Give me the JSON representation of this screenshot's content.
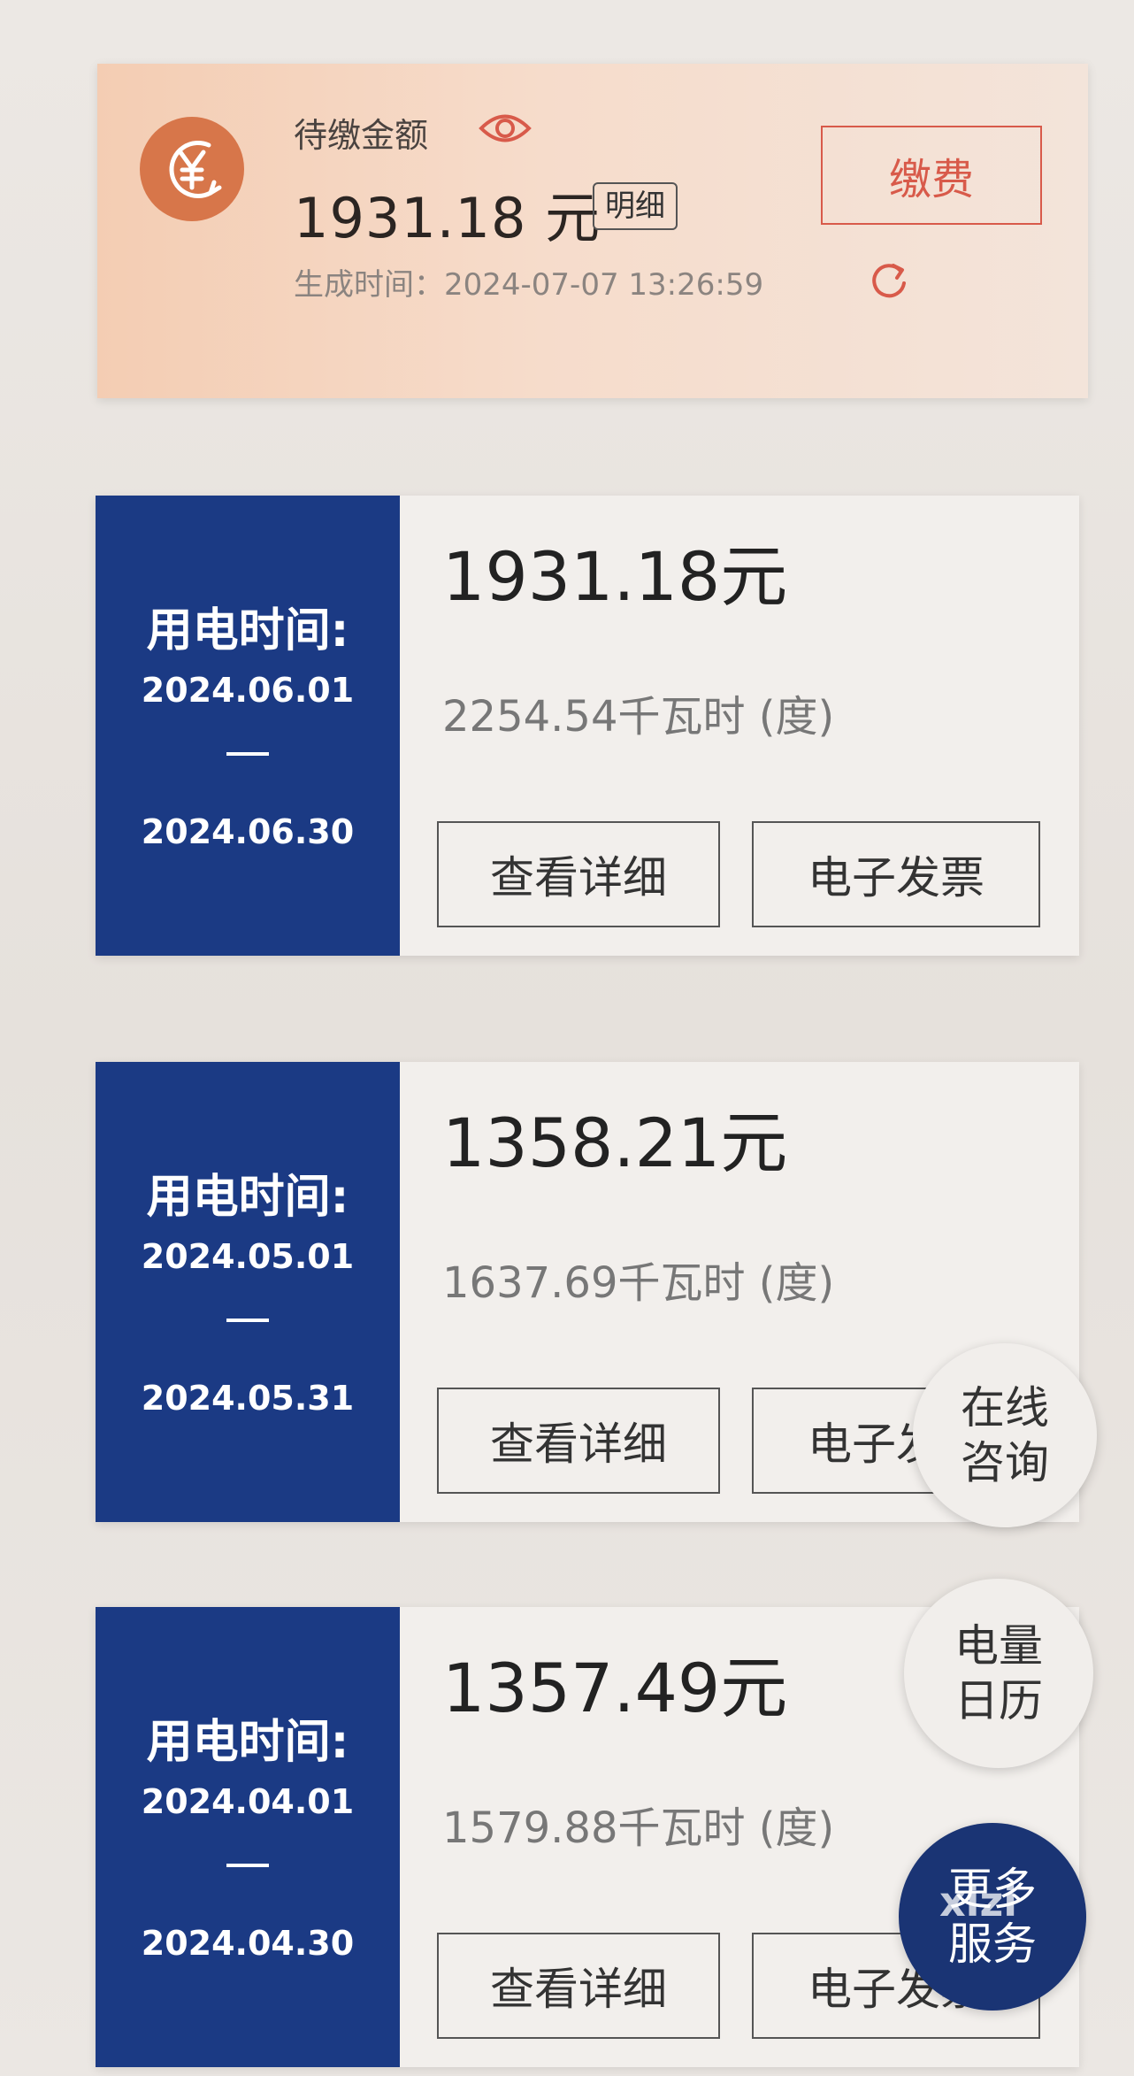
{
  "pending": {
    "label": "待缴金额",
    "amount": "1931.18 元",
    "detail_tag": "明细",
    "generated": "生成时间：2024-07-07 13:26:59",
    "pay_button": "缴费"
  },
  "bills": [
    {
      "side_title": "用电时间:",
      "start": "2024.06.01",
      "end": "2024.06.30",
      "amount": "1931.18元",
      "kwh": "2254.54千瓦时 (度)",
      "detail_button": "查看详细",
      "invoice_button": "电子发票"
    },
    {
      "side_title": "用电时间:",
      "start": "2024.05.01",
      "end": "2024.05.31",
      "amount": "1358.21元",
      "kwh": "1637.69千瓦时 (度)",
      "detail_button": "查看详细",
      "invoice_button": "电子发票"
    },
    {
      "side_title": "用电时间:",
      "start": "2024.04.01",
      "end": "2024.04.30",
      "amount": "1357.49元",
      "kwh": "1579.88千瓦时 (度)",
      "detail_button": "查看详细",
      "invoice_button": "电子发票"
    }
  ],
  "floating": {
    "consult_line1": "在线",
    "consult_line2": "咨询",
    "calendar_line1": "电量",
    "calendar_line2": "日历",
    "more_line1": "更多",
    "more_line2": "服务"
  },
  "watermark": "xizi",
  "icons": {
    "yen": "yen-coin-icon",
    "eye": "eye-icon",
    "refresh": "refresh-icon"
  },
  "colors": {
    "accent": "#d85a4a",
    "navy": "#1b3a84",
    "coin": "#d7764a"
  }
}
